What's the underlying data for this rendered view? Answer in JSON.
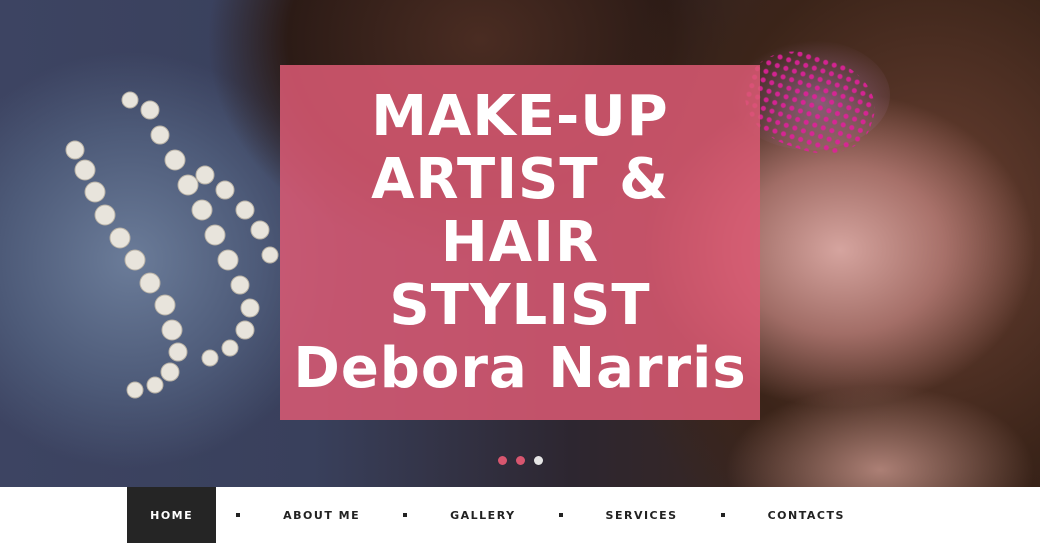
{
  "hero": {
    "title_lines": [
      "MAKE-UP",
      "ARTIST &",
      "HAIR",
      "STYLIST",
      "Debora Narris"
    ],
    "overlay_color": "#db5a73",
    "slides": {
      "count": 3,
      "active": 3
    }
  },
  "nav": {
    "items": [
      {
        "label": "HOME",
        "active": true
      },
      {
        "label": "ABOUT ME",
        "active": false
      },
      {
        "label": "GALLERY",
        "active": false
      },
      {
        "label": "SERVICES",
        "active": false
      },
      {
        "label": "CONTACTS",
        "active": false
      }
    ],
    "active_bg": "#252525"
  }
}
